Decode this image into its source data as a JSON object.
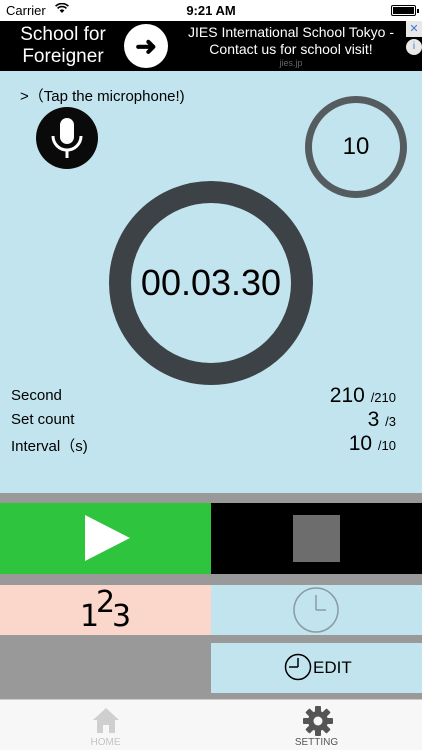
{
  "status_bar": {
    "carrier": "Carrier",
    "time": "9:21 AM"
  },
  "ad": {
    "left_text": "School for Foreigner",
    "right_text": "JIES International School Tokyo - Contact us for school visit!",
    "domain": "jies.jp",
    "close": "✕",
    "info": "i"
  },
  "main": {
    "hint": ">（Tap the microphone!)",
    "small_counter": "10",
    "timer": "00.03.30",
    "stats": [
      {
        "label": "Second",
        "value": "210",
        "total": "/210"
      },
      {
        "label": "Set count",
        "value": "3",
        "total": "/3"
      },
      {
        "label": "Interval（s)",
        "value": "10",
        "total": "/10"
      }
    ]
  },
  "controls": {
    "count_digits": [
      "1",
      "2",
      "3"
    ],
    "edit_label": "EDIT"
  },
  "tabs": [
    {
      "label": "HOME",
      "icon": "home-icon"
    },
    {
      "label": "SETTING",
      "icon": "gear-icon"
    }
  ],
  "colors": {
    "background_blue": "#c2e4ee",
    "play_green": "#2ec43e",
    "count_pink": "#fbd6cb",
    "separator_gray": "#999999"
  }
}
